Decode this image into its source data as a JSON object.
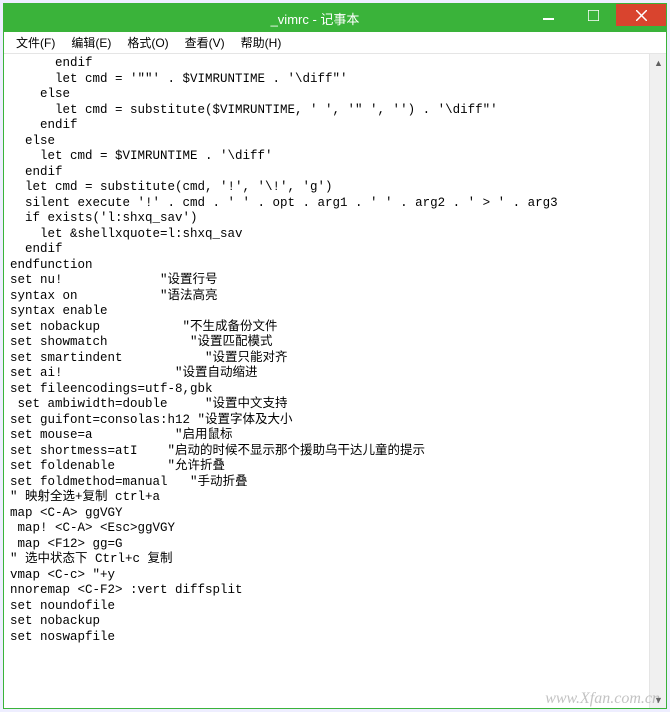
{
  "window": {
    "title": "_vimrc - 记事本"
  },
  "menubar": {
    "items": [
      {
        "label": "文件(F)"
      },
      {
        "label": "编辑(E)"
      },
      {
        "label": "格式(O)"
      },
      {
        "label": "查看(V)"
      },
      {
        "label": "帮助(H)"
      }
    ]
  },
  "content": "      endif\n      let cmd = '\"\"' . $VIMRUNTIME . '\\diff\"'\n    else\n      let cmd = substitute($VIMRUNTIME, ' ', '\" ', '') . '\\diff\"'\n    endif\n  else\n    let cmd = $VIMRUNTIME . '\\diff'\n  endif\n  let cmd = substitute(cmd, '!', '\\!', 'g')\n  silent execute '!' . cmd . ' ' . opt . arg1 . ' ' . arg2 . ' > ' . arg3\n  if exists('l:shxq_sav')\n    let &shellxquote=l:shxq_sav\n  endif\nendfunction\nset nu!             \"设置行号\nsyntax on           \"语法高亮\nsyntax enable\nset nobackup           \"不生成备份文件\nset showmatch           \"设置匹配模式\nset smartindent           \"设置只能对齐\nset ai!               \"设置自动缩进\nset fileencodings=utf-8,gbk\n set ambiwidth=double     \"设置中文支持\nset guifont=consolas:h12 \"设置字体及大小\nset mouse=a           \"启用鼠标\nset shortmess=atI    \"启动的时候不显示那个援助乌干达儿童的提示\nset foldenable       \"允许折叠\nset foldmethod=manual   \"手动折叠\n\" 映射全选+复制 ctrl+a\nmap <C-A> ggVGY\n map! <C-A> <Esc>ggVGY\n map <F12> gg=G\n\" 选中状态下 Ctrl+c 复制\nvmap <C-c> \"+y\nnnoremap <C-F2> :vert diffsplit\nset noundofile\nset nobackup\nset noswapfile",
  "watermark": "www.Xfan.com.cn"
}
